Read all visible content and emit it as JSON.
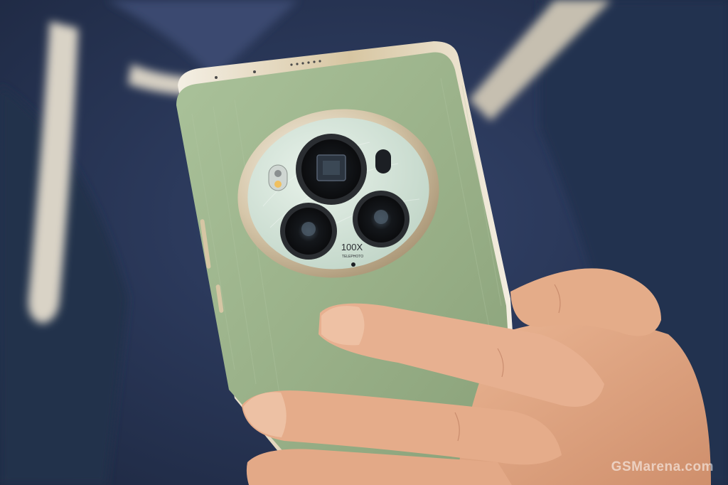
{
  "scene": {
    "description_free": true,
    "colors": {
      "hoodie": "#2b3957",
      "hoodie_dark": "#1e2840",
      "drawstring": "#d8d2c4",
      "phone_back": "#9db48c",
      "phone_frame": "#d9c7a4",
      "camera_ring": "#e6dccb",
      "camera_plate": "#cfe0d4",
      "lens": "#1a1c20",
      "skin": "#e2a986"
    },
    "camera": {
      "zoom_label": "100X",
      "zoom_sub": "TELEPHOTO"
    }
  },
  "watermark": {
    "text": "GSMarena.com"
  }
}
